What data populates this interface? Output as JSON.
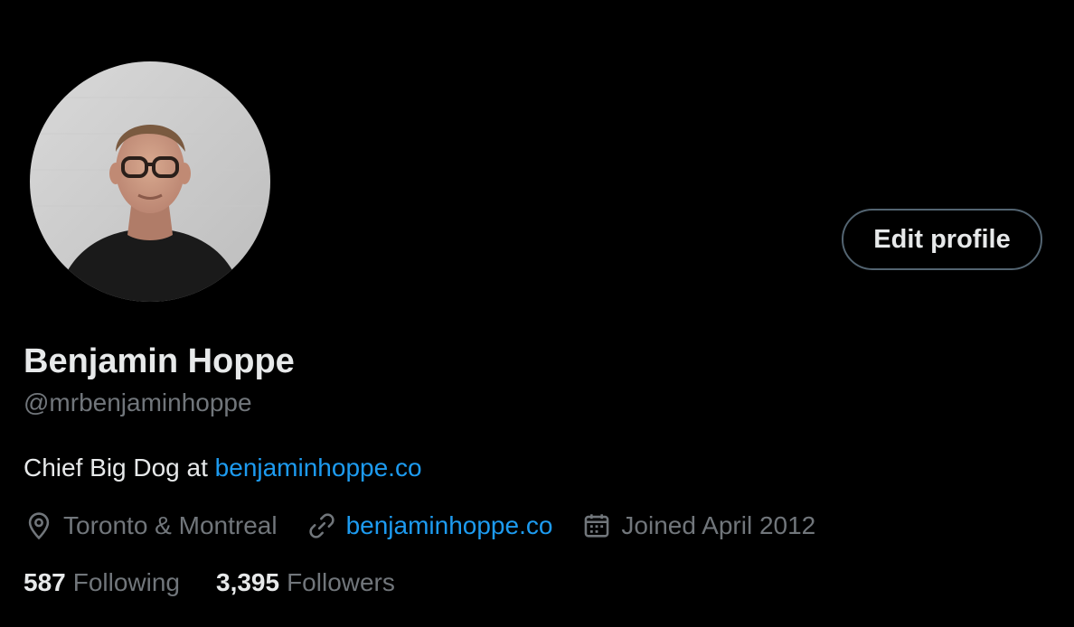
{
  "profile": {
    "display_name": "Benjamin Hoppe",
    "handle": "@mrbenjaminhoppe",
    "bio_text": "Chief Big Dog at ",
    "bio_link": "benjaminhoppe.co",
    "location": "Toronto & Montreal",
    "website": "benjaminhoppe.co",
    "joined": "Joined April 2012",
    "following_count": "587",
    "following_label": "Following",
    "followers_count": "3,395",
    "followers_label": "Followers"
  },
  "actions": {
    "edit_profile_label": "Edit profile"
  },
  "icons": {
    "location": "location-pin-icon",
    "website": "link-icon",
    "joined": "calendar-icon"
  },
  "colors": {
    "background": "#000000",
    "primary_text": "#e7e9ea",
    "secondary_text": "#71767b",
    "link": "#1d9bf0",
    "button_border": "#536471"
  }
}
